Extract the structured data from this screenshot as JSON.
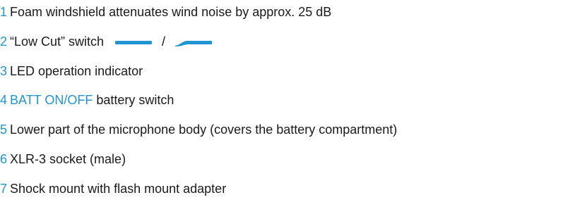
{
  "items": [
    {
      "number": "1",
      "text": "Foam windshield attenuates wind noise by approx. 25 dB"
    },
    {
      "number": "2",
      "text_before": "“Low Cut” switch",
      "separator": "/",
      "icons": [
        "switch-flat-icon",
        "switch-lowcut-icon"
      ]
    },
    {
      "number": "3",
      "text": "LED operation indicator"
    },
    {
      "number": "4",
      "highlight": "BATT ON/OFF",
      "text": "battery switch"
    },
    {
      "number": "5",
      "text": "Lower part of the microphone body (covers the battery compartment)"
    },
    {
      "number": "6",
      "text": "XLR-3 socket (male)"
    },
    {
      "number": "7",
      "text": "Shock mount with flash mount adapter"
    }
  ],
  "colors": {
    "accent": "#1f96d3",
    "text": "#1a1a1a",
    "background": "#ffffff"
  }
}
